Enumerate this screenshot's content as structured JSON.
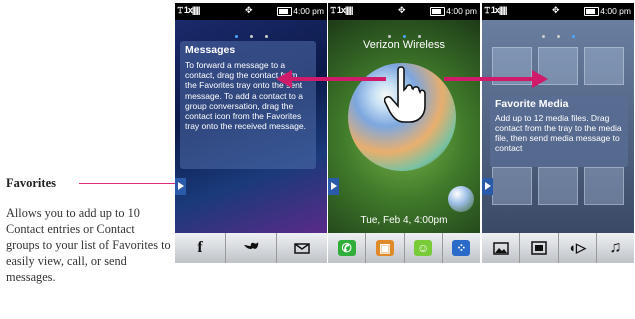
{
  "callout": {
    "title": "Favorites",
    "text": "Allows you to add up to 10 Contact entries or Contact groups to your list of Favorites to easily view, call, or send messages."
  },
  "statusbar": {
    "signal": "1x",
    "time": "4:00 pm"
  },
  "screen1": {
    "box_title": "Messages",
    "box_text": "To forward a message to a contact, drag the contact from the Favorites tray onto the sent message. To add a contact to a group conversation, drag the contact icon from the Favorites tray onto the received message.",
    "dock": [
      "f",
      "twitter-icon",
      "envelope-icon"
    ]
  },
  "screen2": {
    "carrier": "Verizon Wireless",
    "datetime": "Tue, Feb 4, 4:00pm",
    "dock": [
      "phone-icon",
      "contacts-icon",
      "messaging-icon",
      "apps-grid-icon"
    ]
  },
  "screen3": {
    "box_title": "Favorite Media",
    "box_text": "Add up to 12 media files. Drag contact from the tray to the media file, then send media message to contact",
    "dock": [
      "picture-icon",
      "video-icon",
      "ringtone-icon",
      "music-note-icon"
    ]
  },
  "colors": {
    "accent": "#d01a6a",
    "callout_line": "#e0287a"
  }
}
